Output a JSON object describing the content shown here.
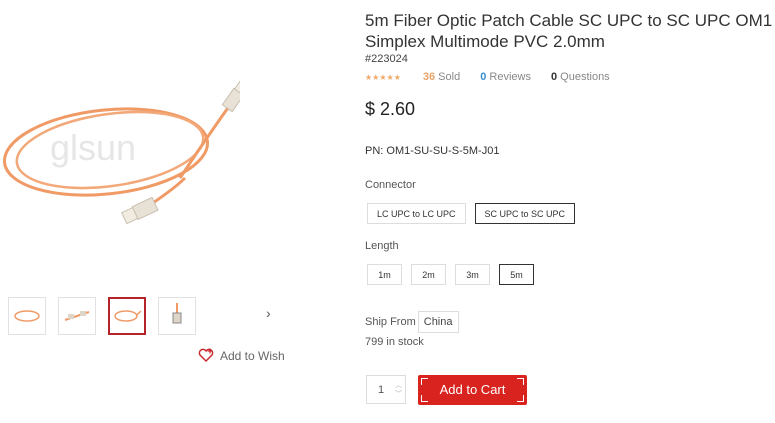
{
  "product": {
    "title": "5m Fiber Optic Patch Cable SC UPC to SC UPC OM1 Simplex Multimode PVC 2.0mm",
    "title_line1": "5m Fiber Optic Patch Cable SC UPC to SC UPC OM1",
    "title_line2": "Simplex Multimode PVC 2.0mm",
    "sku": "#223024",
    "rating_stars": "★★★★★",
    "sold_count": "36",
    "sold_label": "Sold",
    "reviews_count": "0",
    "reviews_label": "Reviews",
    "questions_count": "0",
    "questions_label": "Questions",
    "price": "$ 2.60",
    "pn": "PN: OM1-SU-SU-S-5M-J01"
  },
  "options": {
    "connector_label": "Connector",
    "connectors": [
      "LC UPC to LC UPC",
      "SC UPC to SC UPC"
    ],
    "connector_selected": "SC UPC to SC UPC",
    "length_label": "Length",
    "lengths": [
      "1m",
      "2m",
      "3m",
      "5m"
    ],
    "length_selected": "5m"
  },
  "shipping": {
    "ship_from_label": "Ship From",
    "ship_from_value": "China",
    "stock": "799 in stock"
  },
  "cart": {
    "quantity": "1",
    "add_to_cart_label": "Add to Cart"
  },
  "gallery": {
    "watermark": "glsun",
    "thumb_count": 4,
    "active_thumb": 3,
    "next_icon": "chevron-right-icon",
    "wish_icon": "heart-plus-icon",
    "wish_label": "Add to Wish"
  },
  "colors": {
    "accent": "#d8231f",
    "cable": "#f0a070",
    "star": "#f0a868",
    "link": "#3a8fd1"
  }
}
